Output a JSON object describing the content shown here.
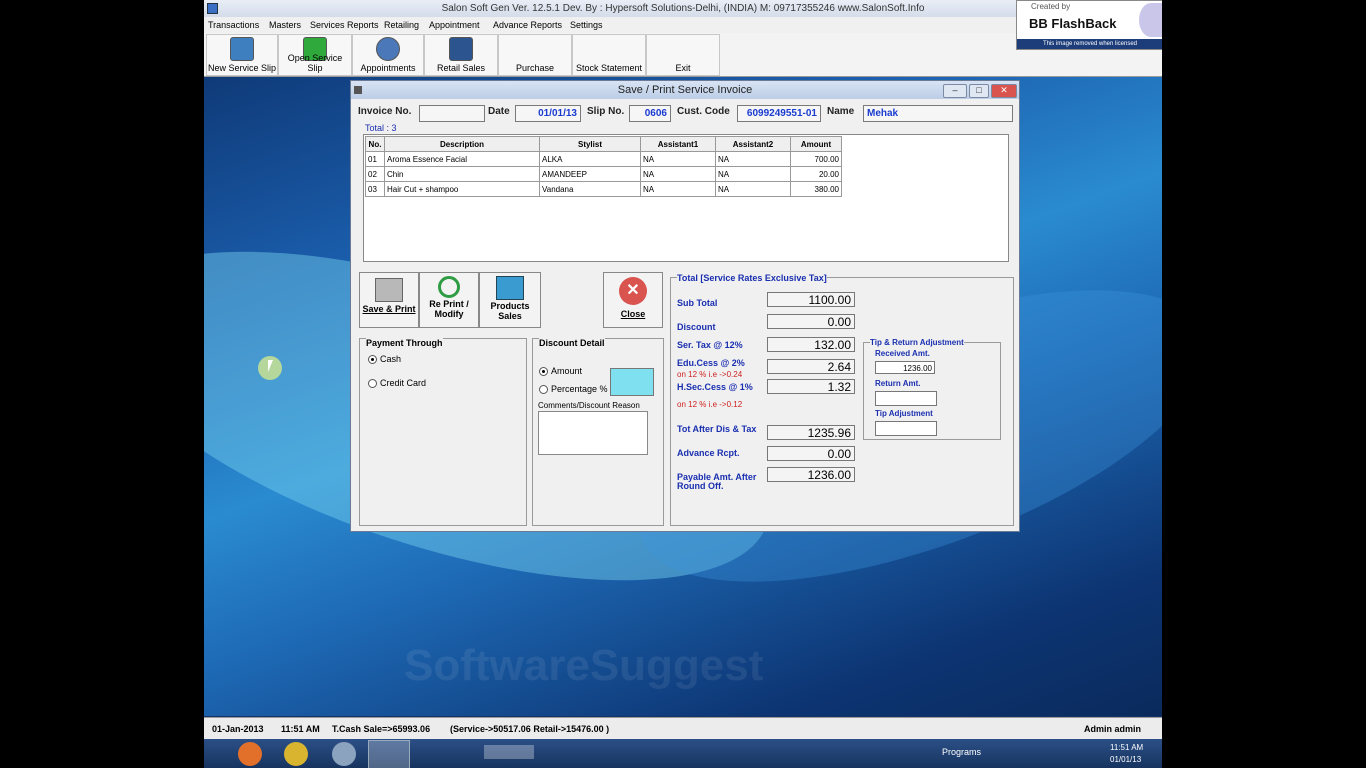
{
  "app": {
    "title": "Salon Soft Gen Ver. 12.5.1 Dev. By : Hypersoft Solutions-Delhi, (INDIA) M: 09717355246  www.SalonSoft.Info",
    "menu": [
      "Transactions",
      "Masters",
      "Services Reports",
      "Retailing",
      "Appointment",
      "Advance Reports",
      "Settings"
    ],
    "toolbar": [
      "New Service Slip",
      "Open Service Slip",
      "Appointments",
      "Retail Sales",
      "Purchase",
      "Stock Statement",
      "Exit"
    ]
  },
  "flashback": {
    "created_by": "Created by",
    "brand": "BB FlashBack",
    "notice": "This image removed when licensed"
  },
  "dialog": {
    "title": "Save / Print Service Invoice",
    "header": {
      "invoice_label": "Invoice No.",
      "invoice_value": "",
      "date_label": "Date",
      "date_value": "01/01/13",
      "slip_label": "Slip No.",
      "slip_value": "0606",
      "cust_label": "Cust. Code",
      "cust_value": "6099249551-01",
      "name_label": "Name",
      "name_value": "Mehak"
    },
    "total_label": "Total : 3",
    "grid": {
      "columns": [
        "No.",
        "Description",
        "Stylist",
        "Assistant1",
        "Assistant2",
        "Amount"
      ],
      "rows": [
        [
          "01",
          "Aroma Essence Facial",
          "ALKA",
          "NA",
          "NA",
          "700.00"
        ],
        [
          "02",
          "Chin",
          "AMANDEEP",
          "NA",
          "NA",
          "20.00"
        ],
        [
          "03",
          "Hair Cut + shampoo",
          "Vandana",
          "NA",
          "NA",
          "380.00"
        ]
      ]
    },
    "buttons": {
      "save_print": "Save & Print",
      "reprint_1": "Re Print /",
      "reprint_2": "Modify",
      "products_1": "Products",
      "products_2": "Sales",
      "close": "Close"
    },
    "payment": {
      "title": "Payment Through",
      "cash": "Cash",
      "credit": "Credit Card"
    },
    "discount": {
      "title": "Discount Detail",
      "amount": "Amount",
      "percentage": "Percentage %",
      "comments": "Comments/Discount Reason"
    },
    "summary": {
      "title": "Total [Service Rates Exclusive Tax]",
      "sub_total_label": "Sub Total",
      "sub_total": "1100.00",
      "discount_label": "Discount",
      "discount": "0.00",
      "ser_tax_label": "Ser. Tax @ 12%",
      "ser_tax": "132.00",
      "edu_cess_label": "Edu.Cess @ 2%",
      "edu_cess": "2.64",
      "edu_note": "on 12 % i.e ->0.24",
      "hsec_label": "H.Sec.Cess @ 1%",
      "hsec": "1.32",
      "hsec_note": "on 12 % i.e ->0.12",
      "tot_after_label": "Tot After Dis & Tax",
      "tot_after": "1235.96",
      "advance_label": "Advance Rcpt.",
      "advance": "0.00",
      "payable_label_1": "Payable Amt. After",
      "payable_label_2": "Round Off.",
      "payable": "1236.00"
    },
    "tip": {
      "title": "Tip & Return Adjustment",
      "received_label": "Received Amt.",
      "received": "1236.00",
      "return_label": "Return Amt.",
      "return_value": "",
      "tip_label": "Tip Adjustment",
      "tip_value": ""
    }
  },
  "status": {
    "date": "01-Jan-2013",
    "time": "11:51 AM",
    "cash_sale": "T.Cash Sale=>65993.06",
    "split": "(Service->50517.06  Retail->15476.00 )",
    "user": "Admin admin"
  },
  "taskbar": {
    "programs": "Programs",
    "clock_time": "11:51 AM",
    "clock_date": "01/01/13"
  },
  "watermark": "SoftwareSuggest",
  "colors": {
    "accent_text": "#1a2fb0",
    "value_text": "#1a3bd0",
    "note_red": "#d02020",
    "discount_swatch": "#7fe0f0"
  }
}
